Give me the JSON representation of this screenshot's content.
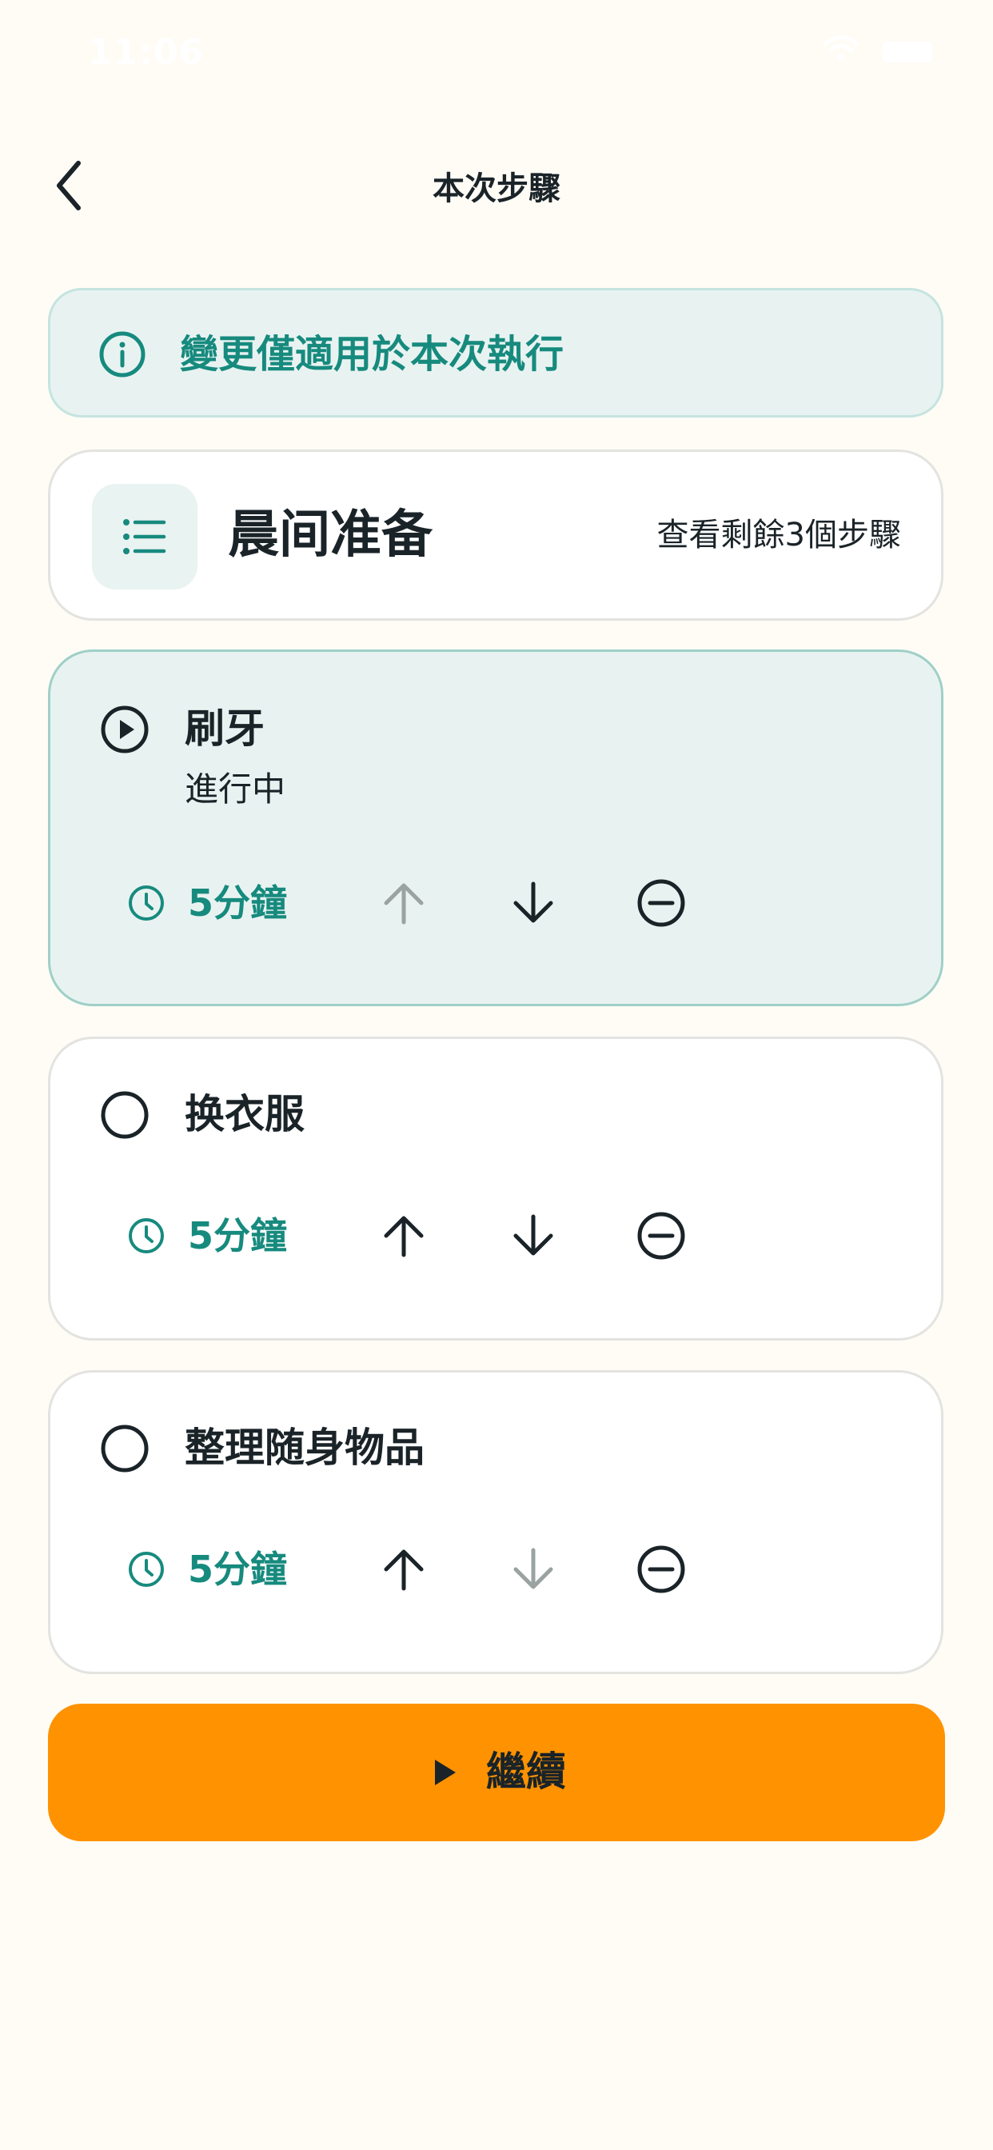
{
  "status_bar": {
    "time": "11:06"
  },
  "header": {
    "title": "本次步驟"
  },
  "banner": {
    "text": "變更僅適用於本次執行"
  },
  "routine": {
    "name": "晨间准备",
    "link": "查看剩餘3個步驟"
  },
  "steps": [
    {
      "name": "刷牙",
      "status": "進行中",
      "duration": "5分鐘",
      "move_up_enabled": false,
      "move_down_enabled": true
    },
    {
      "name": "换衣服",
      "duration": "5分鐘",
      "move_up_enabled": true,
      "move_down_enabled": true
    },
    {
      "name": "整理随身物品",
      "duration": "5分鐘",
      "move_up_enabled": true,
      "move_down_enabled": false
    }
  ],
  "continue_button": {
    "label": "繼續"
  },
  "colors": {
    "background": "#FFFCF6",
    "accent_teal": "#178A7E",
    "active_card": "#E8F3F1",
    "primary_button": "#FF9200",
    "text": "#1A2328",
    "disabled_icon": "#9AA3A2"
  }
}
